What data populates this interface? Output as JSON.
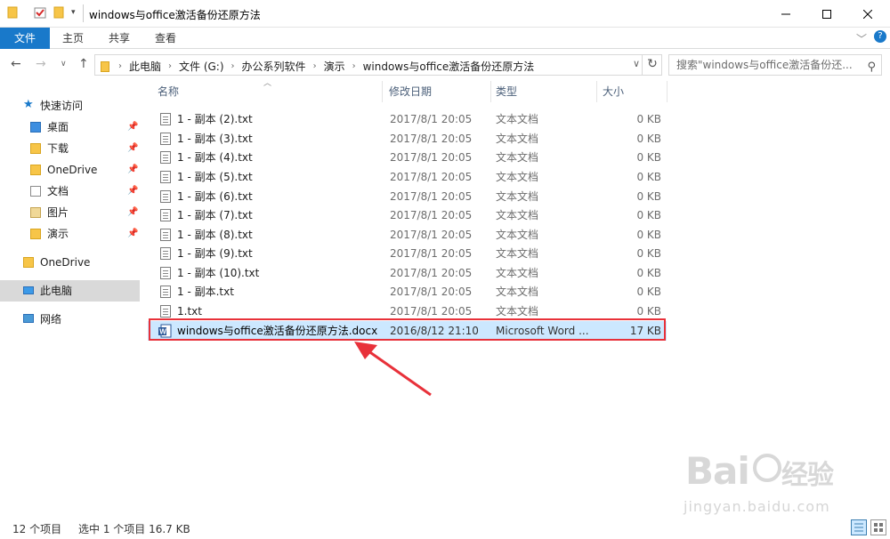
{
  "window": {
    "title": "windows与office激活备份还原方法"
  },
  "ribbon": {
    "tabs": [
      "文件",
      "主页",
      "共享",
      "查看"
    ]
  },
  "address": {
    "crumbs": [
      "此电脑",
      "文件 (G:)",
      "办公系列软件",
      "演示",
      "windows与office激活备份还原方法"
    ]
  },
  "search": {
    "placeholder": "搜索\"windows与office激活备份还..."
  },
  "nav": {
    "quick_access": "快速访问",
    "pinned": [
      "桌面",
      "下载",
      "OneDrive",
      "文档",
      "图片",
      "演示"
    ],
    "onedrive": "OneDrive",
    "this_pc": "此电脑",
    "network": "网络"
  },
  "columns": {
    "name": "名称",
    "date": "修改日期",
    "type": "类型",
    "size": "大小"
  },
  "files": [
    {
      "name": "1 - 副本 (2).txt",
      "date": "2017/8/1 20:05",
      "type": "文本文档",
      "size": "0 KB"
    },
    {
      "name": "1 - 副本 (3).txt",
      "date": "2017/8/1 20:05",
      "type": "文本文档",
      "size": "0 KB"
    },
    {
      "name": "1 - 副本 (4).txt",
      "date": "2017/8/1 20:05",
      "type": "文本文档",
      "size": "0 KB"
    },
    {
      "name": "1 - 副本 (5).txt",
      "date": "2017/8/1 20:05",
      "type": "文本文档",
      "size": "0 KB"
    },
    {
      "name": "1 - 副本 (6).txt",
      "date": "2017/8/1 20:05",
      "type": "文本文档",
      "size": "0 KB"
    },
    {
      "name": "1 - 副本 (7).txt",
      "date": "2017/8/1 20:05",
      "type": "文本文档",
      "size": "0 KB"
    },
    {
      "name": "1 - 副本 (8).txt",
      "date": "2017/8/1 20:05",
      "type": "文本文档",
      "size": "0 KB"
    },
    {
      "name": "1 - 副本 (9).txt",
      "date": "2017/8/1 20:05",
      "type": "文本文档",
      "size": "0 KB"
    },
    {
      "name": "1 - 副本 (10).txt",
      "date": "2017/8/1 20:05",
      "type": "文本文档",
      "size": "0 KB"
    },
    {
      "name": "1 - 副本.txt",
      "date": "2017/8/1 20:05",
      "type": "文本文档",
      "size": "0 KB"
    },
    {
      "name": "1.txt",
      "date": "2017/8/1 20:05",
      "type": "文本文档",
      "size": "0 KB"
    },
    {
      "name": "windows与office激活备份还原方法.docx",
      "date": "2016/8/12 21:10",
      "type": "Microsoft Word ...",
      "size": "17 KB"
    }
  ],
  "status": {
    "count": "12 个项目",
    "selection": "选中 1 个项目  16.7 KB"
  },
  "watermark": {
    "logo": "Baidu经验",
    "url": "jingyan.baidu.com"
  },
  "colors": {
    "accent": "#1979ca",
    "selection": "#cce8ff",
    "annotation": "#e8313a"
  }
}
